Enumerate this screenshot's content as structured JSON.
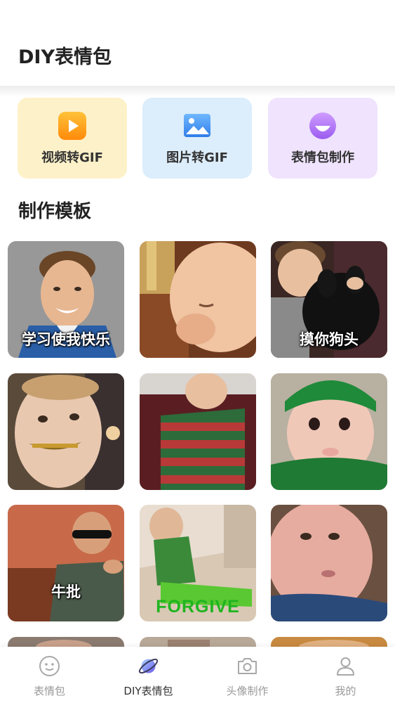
{
  "header": {
    "title": "DIY表情包"
  },
  "tools": [
    {
      "label": "视频转GIF",
      "icon": "video-play-icon",
      "bg": "#fdf1c9"
    },
    {
      "label": "图片转GIF",
      "icon": "image-icon",
      "bg": "#dcedfb"
    },
    {
      "label": "表情包制作",
      "icon": "smile-face-icon",
      "bg": "#efe3fd"
    }
  ],
  "templates": {
    "title": "制作模板",
    "items": [
      {
        "caption": "学习使我快乐"
      },
      {
        "caption": ""
      },
      {
        "caption": "摸你狗头"
      },
      {
        "caption": ""
      },
      {
        "caption": ""
      },
      {
        "caption": ""
      },
      {
        "caption": "牛批"
      },
      {
        "caption": "FORGIVE"
      },
      {
        "caption": ""
      }
    ]
  },
  "nav": {
    "items": [
      {
        "label": "表情包",
        "icon": "smiley-icon",
        "active": false
      },
      {
        "label": "DIY表情包",
        "icon": "planet-icon",
        "active": true
      },
      {
        "label": "头像制作",
        "icon": "camera-icon",
        "active": false
      },
      {
        "label": "我的",
        "icon": "user-icon",
        "active": false
      }
    ]
  },
  "colors": {
    "accent_orange": "#ff9f1c",
    "accent_blue": "#3a8ef5",
    "accent_purple": "#b276f5",
    "caption_green": "#1fb41f"
  }
}
